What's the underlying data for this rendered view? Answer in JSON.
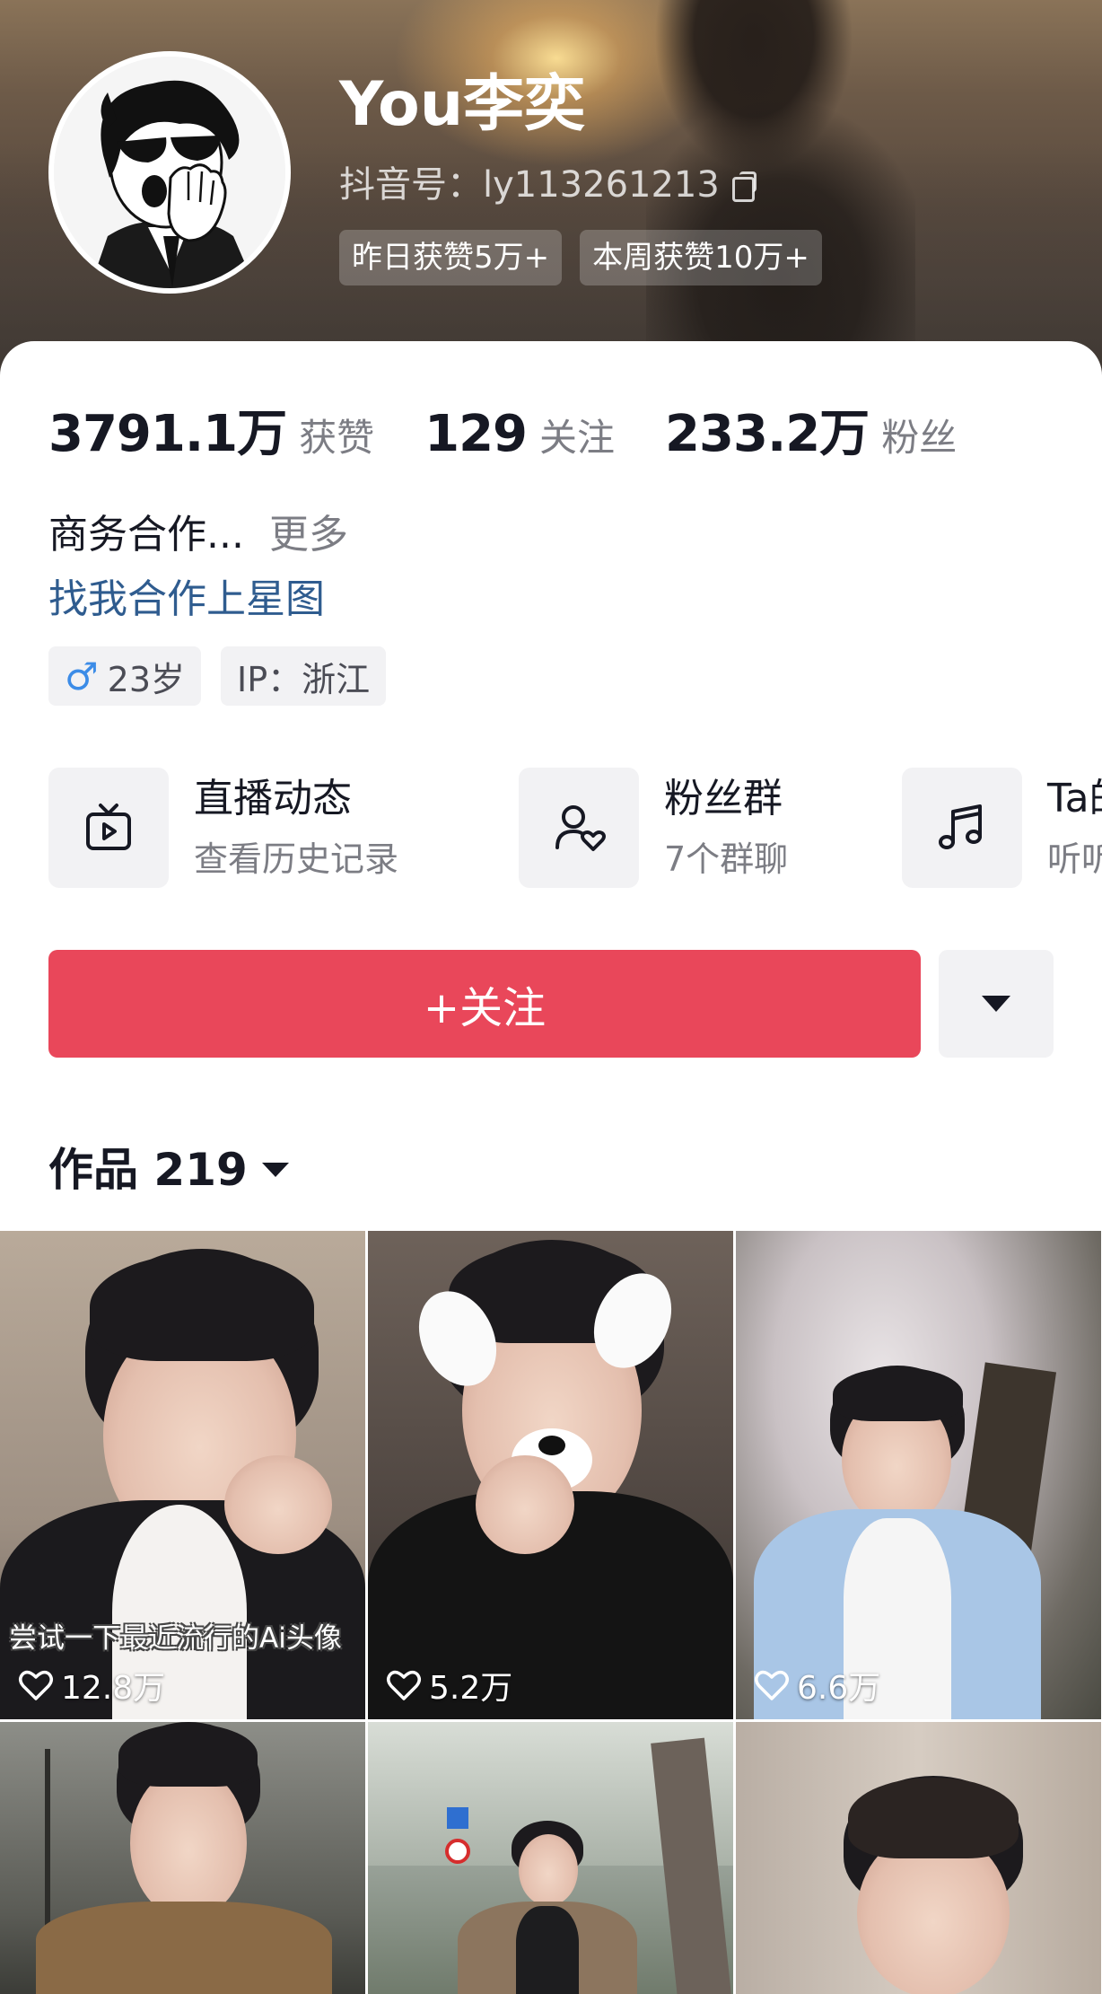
{
  "profile": {
    "nickname": "You李奕",
    "douyin_id": "抖音号：ly113261213",
    "badges": [
      "昨日获赞5万+",
      "本周获赞10万+"
    ]
  },
  "stats": [
    {
      "value": "3791.1万",
      "label": "获赞"
    },
    {
      "value": "129",
      "label": "关注"
    },
    {
      "value": "233.2万",
      "label": "粉丝"
    }
  ],
  "bio": {
    "text": "商务合作...",
    "more": "更多",
    "link": "找我合作上星图"
  },
  "tags": {
    "gender_icon": "♂",
    "age": "23岁",
    "ip": "IP：浙江"
  },
  "features": [
    {
      "icon": "tv-icon",
      "title": "直播动态",
      "subtitle": "查看历史记录"
    },
    {
      "icon": "fan-group-icon",
      "title": "粉丝群",
      "subtitle": "7个群聊"
    },
    {
      "icon": "music-icon",
      "title": "Ta的",
      "subtitle": "听听"
    }
  ],
  "follow": {
    "label": "+关注"
  },
  "works": {
    "tab_label": "作品 219"
  },
  "videos": [
    {
      "caption": "尝试一下最近流行的Ai头像",
      "likes": "12.8万"
    },
    {
      "caption": "",
      "likes": "5.2万"
    },
    {
      "caption": "",
      "likes": "6.6万"
    },
    {
      "caption": "",
      "likes": ""
    },
    {
      "caption": "",
      "likes": ""
    },
    {
      "caption": "",
      "likes": ""
    }
  ],
  "colors": {
    "follow_button": "#e9475a",
    "link": "#2f5c8f",
    "secondary_text": "#7c7d84"
  }
}
